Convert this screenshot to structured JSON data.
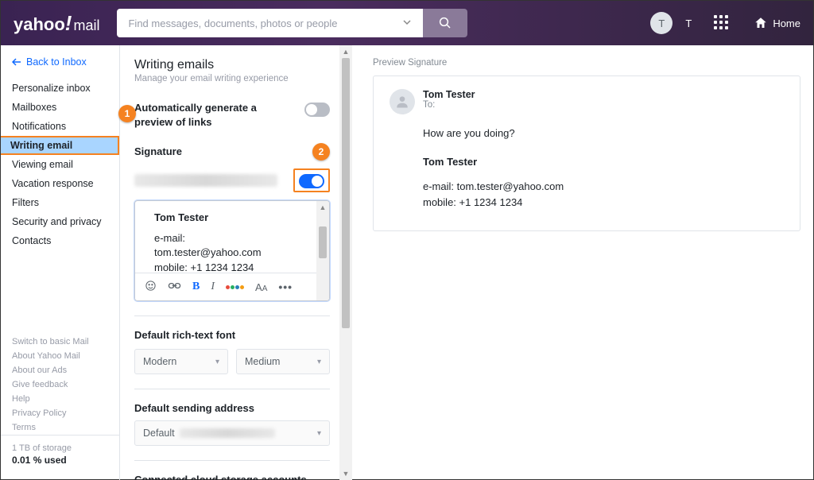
{
  "header": {
    "logo_brand": "yahoo",
    "logo_excl": "!",
    "logo_product": "mail",
    "search_placeholder": "Find messages, documents, photos or people",
    "avatar_initial": "T",
    "home_label": "Home"
  },
  "sidebar": {
    "back_label": "Back to Inbox",
    "items": [
      {
        "label": "Personalize inbox"
      },
      {
        "label": "Mailboxes"
      },
      {
        "label": "Notifications"
      },
      {
        "label": "Writing email"
      },
      {
        "label": "Viewing email"
      },
      {
        "label": "Vacation response"
      },
      {
        "label": "Filters"
      },
      {
        "label": "Security and privacy"
      },
      {
        "label": "Contacts"
      }
    ],
    "secondary": [
      {
        "label": "Switch to basic Mail"
      },
      {
        "label": "About Yahoo Mail"
      },
      {
        "label": "About our Ads"
      },
      {
        "label": "Give feedback"
      },
      {
        "label": "Help"
      },
      {
        "label": "Privacy Policy"
      },
      {
        "label": "Terms"
      }
    ],
    "storage_total": "1 TB of storage",
    "storage_used": "0.01 % used"
  },
  "settings": {
    "title": "Writing emails",
    "subtitle": "Manage your email writing experience",
    "auto_preview_label": "Automatically generate a preview of links",
    "signature_label": "Signature",
    "editor": {
      "name": "Tom Tester",
      "line1": "e-mail:",
      "line2": "tom.tester@yahoo.com",
      "line3": "mobile: +1 1234 1234"
    },
    "font_section": "Default rich-text font",
    "font_family": "Modern",
    "font_size": "Medium",
    "address_section": "Default sending address",
    "address_value": "Default",
    "cloud_section": "Connected cloud storage accounts"
  },
  "preview": {
    "label": "Preview Signature",
    "from": "Tom Tester",
    "to_label": "To:",
    "body_greeting": "How are you doing?",
    "sig_name": "Tom Tester",
    "sig_email": "e-mail: tom.tester@yahoo.com",
    "sig_mobile": "mobile: +1 1234 1234"
  },
  "annotations": {
    "one": "1",
    "two": "2"
  }
}
